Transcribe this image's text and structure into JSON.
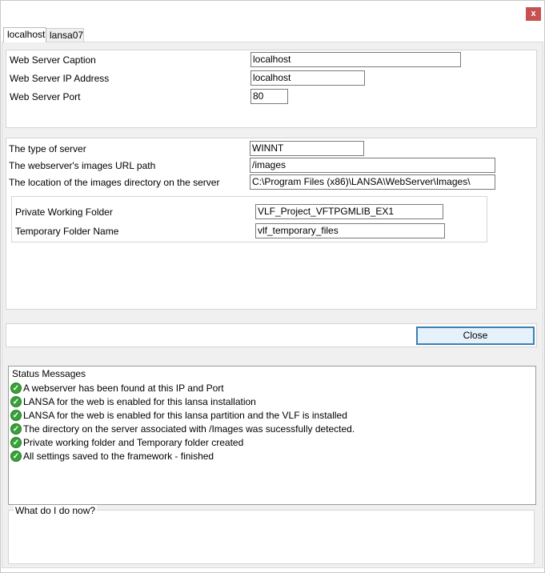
{
  "window": {
    "close_glyph": "x"
  },
  "tabs": [
    {
      "label": "localhost",
      "active": true
    },
    {
      "label": "lansa07",
      "active": false
    }
  ],
  "server": {
    "caption_label": "Web Server Caption",
    "caption_value": "localhost",
    "ip_label": "Web Server IP Address",
    "ip_value": "localhost",
    "port_label": "Web Server Port",
    "port_value": "80"
  },
  "images": {
    "type_label": "The type of server",
    "type_value": "WINNT",
    "url_label": "The webserver's images URL path",
    "url_value": "/images",
    "dir_label": "The location of the images directory on the server",
    "dir_value": "C:\\Program Files (x86)\\LANSA\\WebServer\\Images\\"
  },
  "folders": {
    "private_label": "Private Working Folder",
    "private_value": "VLF_Project_VFTPGMLIB_EX1",
    "temp_label": "Temporary Folder Name",
    "temp_value": "vlf_temporary_files"
  },
  "actions": {
    "close_label": "Close"
  },
  "status": {
    "title": "Status Messages",
    "icon": "check-circle-icon",
    "messages": [
      "A webserver has been found at this IP and Port",
      "LANSA for the web is enabled for this lansa installation",
      "LANSA for the web is enabled for this lansa partition and the VLF is installed",
      "The directory on the server associated with /Images was sucessfully detected.",
      "Private working folder and Temporary folder created",
      "All settings saved to the framework - finished"
    ]
  },
  "help": {
    "title": "What do I do now?"
  },
  "colors": {
    "accent": "#3c7fb1",
    "success": "#3aa13a",
    "close_red": "#c75050"
  }
}
